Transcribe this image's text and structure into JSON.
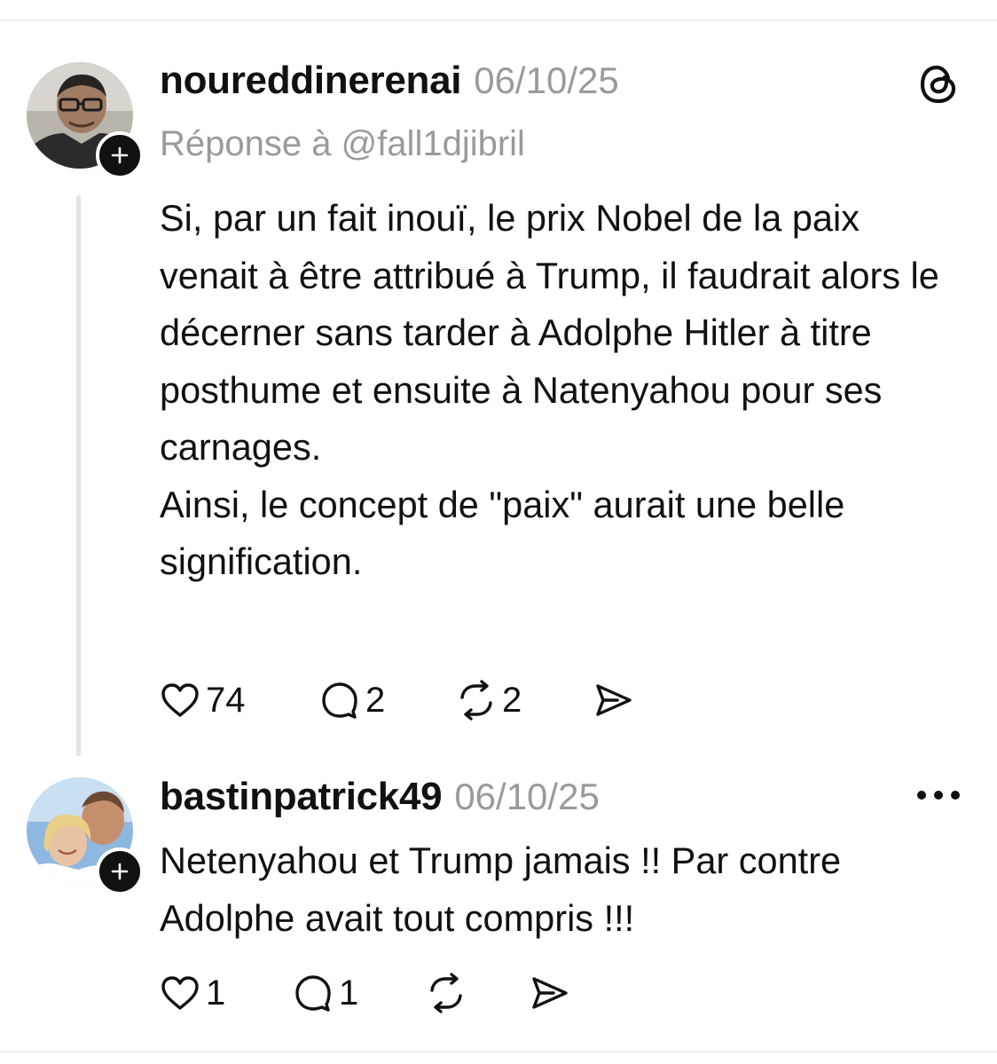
{
  "post": {
    "username": "noureddinerenai",
    "date": "06/10/25",
    "reply_to": "Réponse à @fall1djibril",
    "paragraphs": [
      "Si, par un fait inouï, le prix Nobel de la paix venait à être attribué à Trump, il faudrait alors le décerner sans tarder à Adolphe Hitler à titre posthume et ensuite à Natenyahou pour ses carnages.",
      "Ainsi, le concept de \"paix\" aurait une belle signification."
    ],
    "likes": "74",
    "replies": "2",
    "reposts": "2"
  },
  "reply": {
    "username": "bastinpatrick49",
    "date": "06/10/25",
    "text": "Netenyahou et Trump jamais !! Par contre Adolphe avait tout compris !!!",
    "likes": "1",
    "replies": "1",
    "reposts": ""
  },
  "icons": {
    "app": "threads-logo-icon",
    "menu": "more-options-icon",
    "like": "heart-icon",
    "reply": "comment-icon",
    "repost": "repost-icon",
    "share": "send-icon",
    "follow": "plus-icon"
  }
}
